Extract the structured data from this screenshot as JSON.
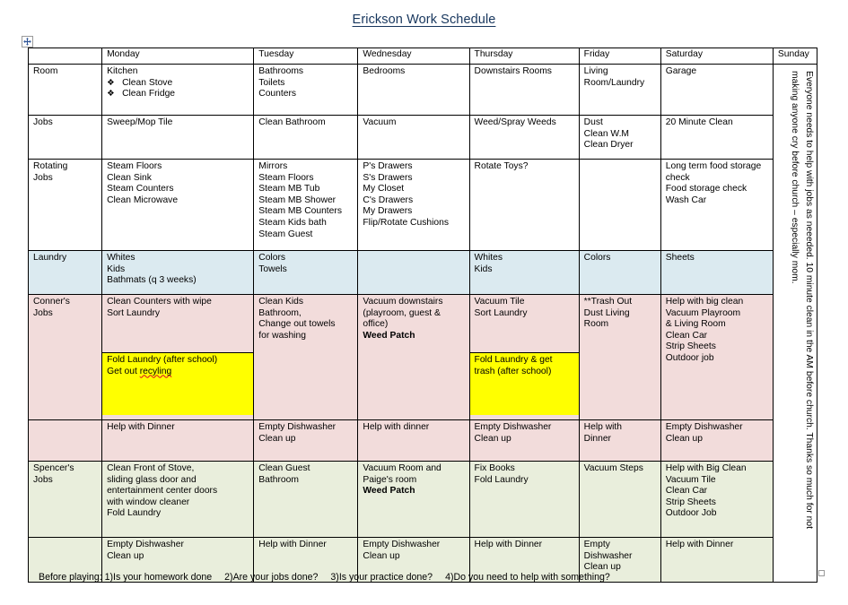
{
  "document": {
    "title": "Erickson Work Schedule",
    "move_handle_icon": "move-four-arrows-icon",
    "resize_handle_icon": "resize-handle-icon",
    "footer": {
      "intro": "Before playing: 1)Is your homework done",
      "q2": "2)Are your jobs done?",
      "q3": "3)Is your practice done?",
      "q4": "4)Do you need to help with something?"
    }
  },
  "colors": {
    "title": "#17365d",
    "laundry_row": "#dbeaf0",
    "conner_row": "#f2dcdb",
    "spencer_row": "#e9eedc",
    "highlight": "#ffff00",
    "border": "#000000"
  },
  "table": {
    "columns": [
      "",
      "Monday",
      "Tuesday",
      "Wednesday",
      "Thursday",
      "Friday",
      "Saturday",
      "Sunday"
    ],
    "rows": [
      {
        "label": "Room",
        "band": "white",
        "monday": [
          "Kitchen",
          "Clean Stove",
          "Clean Fridge"
        ],
        "tuesday": [
          "Bathrooms",
          "Toilets",
          "Counters"
        ],
        "wednesday": [
          "Bedrooms"
        ],
        "thursday": [
          "Downstairs Rooms"
        ],
        "friday": [
          "Living",
          "Room/Laundry"
        ],
        "saturday": [
          "Garage"
        ]
      },
      {
        "label": "Jobs",
        "band": "white",
        "monday": [
          "Sweep/Mop Tile"
        ],
        "tuesday": [
          "Clean Bathroom"
        ],
        "wednesday": [
          "Vacuum"
        ],
        "thursday": [
          "Weed/Spray Weeds"
        ],
        "friday": [
          "Dust",
          "Clean W.M",
          "Clean Dryer"
        ],
        "saturday": [
          "20 Minute Clean"
        ]
      },
      {
        "label": "Rotating Jobs",
        "band": "white",
        "monday": [
          "Steam Floors",
          "Clean Sink",
          "Steam Counters",
          "Clean Microwave"
        ],
        "tuesday": [
          "Mirrors",
          "Steam Floors",
          "Steam MB Tub",
          "Steam MB Shower",
          "Steam MB Counters",
          "Steam Kids bath",
          "Steam Guest"
        ],
        "wednesday": [
          "P's Drawers",
          "S's Drawers",
          "My Closet",
          "C's Drawers",
          "My Drawers",
          "Flip/Rotate Cushions"
        ],
        "thursday": [
          "Rotate Toys?"
        ],
        "friday": [],
        "saturday": [
          "Long term food storage check",
          "Food storage check",
          "Wash Car"
        ]
      },
      {
        "label": "Laundry",
        "band": "blue",
        "monday": [
          "Whites",
          "Kids",
          "Bathmats (q 3 weeks)"
        ],
        "tuesday": [
          "Colors",
          "Towels"
        ],
        "wednesday": [],
        "thursday": [
          "Whites",
          "Kids"
        ],
        "friday": [
          "Colors"
        ],
        "saturday": [
          "Sheets"
        ]
      },
      {
        "label": "Conner's Jobs",
        "band": "pink",
        "monday": [
          "Clean Counters with wipe",
          "Sort Laundry"
        ],
        "monday_highlight": [
          "Fold Laundry (after school)",
          "Get out recyling"
        ],
        "tuesday": [
          "Clean Kids",
          "Bathroom,",
          "Change out towels",
          "for washing"
        ],
        "wednesday": [
          "Vacuum downstairs",
          "(playroom, guest & office)",
          "Weed Patch"
        ],
        "thursday": [
          "Vacuum Tile",
          "Sort Laundry"
        ],
        "thursday_highlight": [
          "Fold Laundry & get trash (after school)"
        ],
        "friday": [
          "**Trash Out",
          "Dust Living",
          "Room"
        ],
        "saturday": [
          "Help with big clean",
          "Vacuum Playroom",
          "& Living Room",
          "Clean Car",
          "Strip Sheets",
          "Outdoor job"
        ]
      },
      {
        "label": "",
        "band": "pink",
        "monday": [
          "Help with Dinner"
        ],
        "tuesday": [
          "Empty Dishwasher",
          "Clean up"
        ],
        "wednesday": [
          "Help with dinner"
        ],
        "thursday": [
          "Empty Dishwasher",
          "Clean up"
        ],
        "friday": [
          "Help with",
          "Dinner"
        ],
        "saturday": [
          "Empty Dishwasher",
          "Clean up"
        ]
      },
      {
        "label": "Spencer's Jobs",
        "band": "green",
        "monday": [
          "Clean Front of Stove,",
          "sliding glass door and",
          "entertainment center doors",
          "with window cleaner",
          "Fold Laundry"
        ],
        "tuesday": [
          "Clean Guest",
          "Bathroom"
        ],
        "wednesday": [
          "Vacuum Room and",
          "Paige's room",
          "Weed Patch"
        ],
        "thursday": [
          "Fix Books",
          "Fold Laundry"
        ],
        "friday": [
          "Vacuum Steps"
        ],
        "saturday": [
          "Help with Big Clean",
          "Vacuum Tile",
          "Clean Car",
          "Strip Sheets",
          "Outdoor Job"
        ]
      },
      {
        "label": "",
        "band": "green",
        "monday": [
          "Empty Dishwasher",
          "Clean up"
        ],
        "tuesday": [
          "Help with Dinner"
        ],
        "wednesday": [
          "Empty Dishwasher",
          "Clean up"
        ],
        "thursday": [
          "Help with Dinner"
        ],
        "friday": [
          "Empty",
          "Dishwasher",
          "Clean up"
        ],
        "saturday": [
          "Help with Dinner"
        ]
      }
    ],
    "sunday_note": "Everyone needs to help with jobs as neeeded. 10 minute clean in the AM before church.  Thanks so much for not making anyone cry before church – especially mom."
  }
}
